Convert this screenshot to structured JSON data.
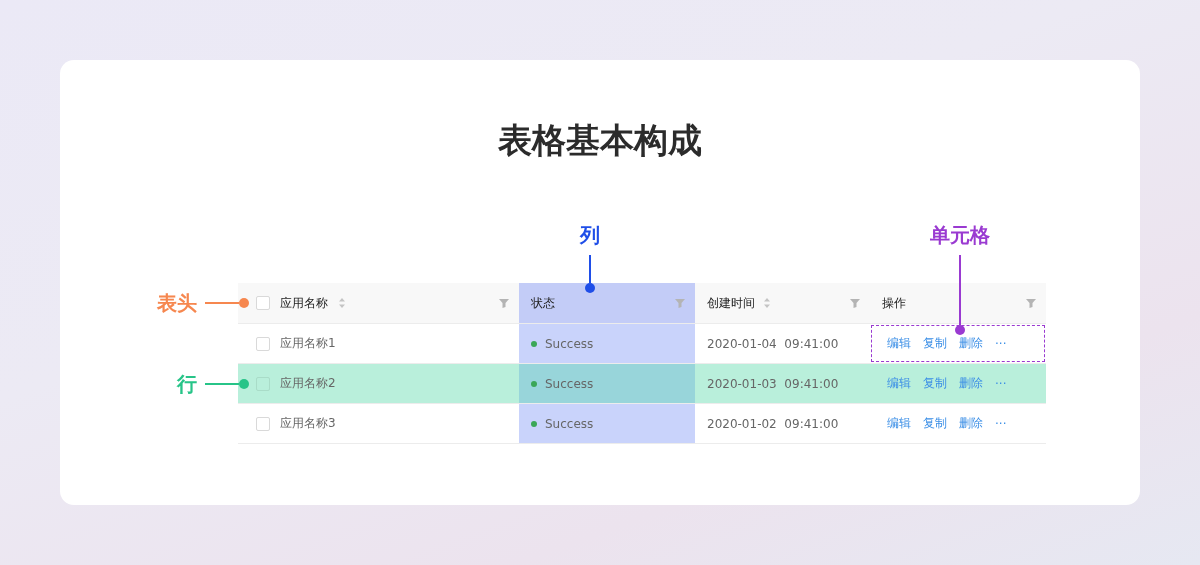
{
  "title": "表格基本构成",
  "annotations": [
    {
      "kind": "column",
      "label": "列",
      "color": "#1f4ee8"
    },
    {
      "kind": "cell",
      "label": "单元格",
      "color": "#9a3ad1"
    },
    {
      "kind": "header",
      "label": "表头",
      "color": "#f6874f"
    },
    {
      "kind": "row",
      "label": "行",
      "color": "#27c488"
    }
  ],
  "table": {
    "header_checkbox": {
      "checked": false
    },
    "columns": [
      {
        "title": "应用名称",
        "sortable": true,
        "filter": true,
        "highlighted": false
      },
      {
        "title": "状态",
        "sortable": false,
        "filter": true,
        "highlighted": true
      },
      {
        "title": "创建时间",
        "sortable": true,
        "filter": true,
        "highlighted": false
      },
      {
        "title": "操作",
        "sortable": false,
        "filter": true,
        "highlighted": false
      }
    ],
    "rows": [
      {
        "checked": false,
        "highlighted": false,
        "name": "应用名称1",
        "status": "Success",
        "created": "2020-01-04  09:41:00",
        "actions": [
          "编辑",
          "复制",
          "删除",
          "···"
        ],
        "actions_cell_highlighted": true
      },
      {
        "checked": false,
        "highlighted": true,
        "name": "应用名称2",
        "status": "Success",
        "created": "2020-01-03  09:41:00",
        "actions": [
          "编辑",
          "复制",
          "删除",
          "···"
        ],
        "actions_cell_highlighted": false
      },
      {
        "checked": false,
        "highlighted": false,
        "name": "应用名称3",
        "status": "Success",
        "created": "2020-01-02  09:41:00",
        "actions": [
          "编辑",
          "复制",
          "删除",
          "···"
        ],
        "actions_cell_highlighted": false
      }
    ]
  }
}
